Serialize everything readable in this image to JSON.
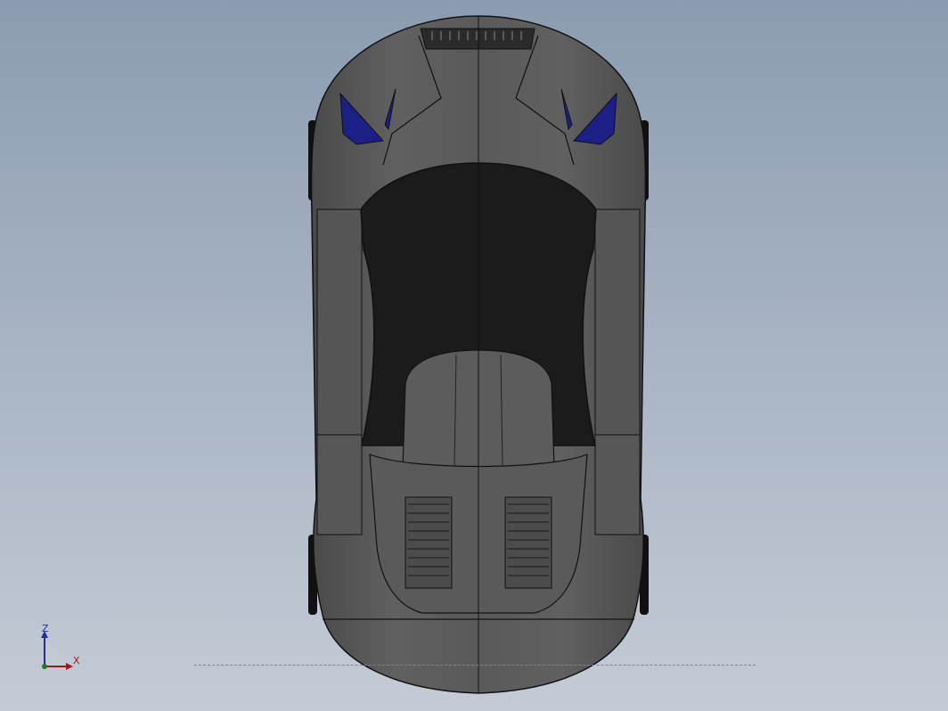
{
  "viewport": {
    "background_top": "#8b9cb1",
    "background_bottom": "#c4cbd6",
    "model": {
      "description_icon": "sports-car-top-view",
      "body_color": "#5e5e5e",
      "dark_color": "#1b1b1b",
      "accent_color": "#1c1f86",
      "edge_color": "#111111"
    }
  },
  "triad": {
    "z_label": "Z",
    "x_label": "X",
    "z_color": "#1f2fa8",
    "x_color": "#a01818"
  }
}
